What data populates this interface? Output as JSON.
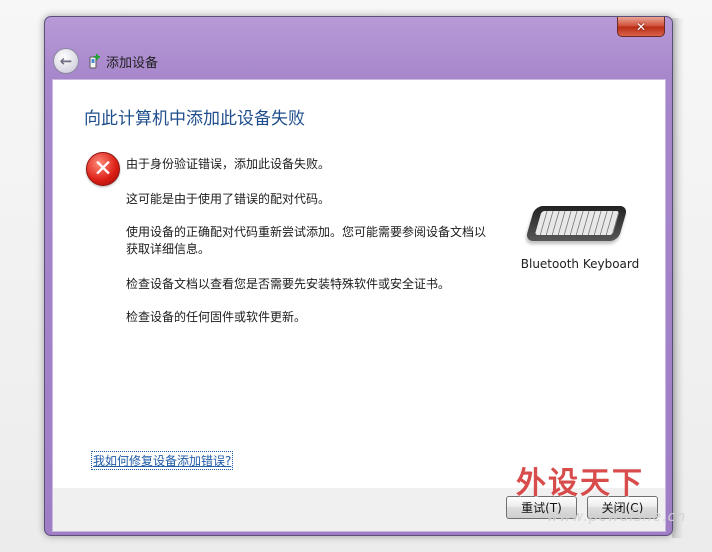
{
  "window": {
    "title": "添加设备",
    "close_label": "✕"
  },
  "navigation": {
    "back_label": "←"
  },
  "content": {
    "heading": "向此计算机中添加此设备失败",
    "messages": [
      "由于身份验证错误，添加此设备失败。",
      "这可能是由于使用了错误的配对代码。",
      "使用设备的正确配对代码重新尝试添加。您可能需要参阅设备文档以获取详细信息。",
      "检查设备文档以查看您是否需要先安装特殊软件或安全证书。",
      "检查设备的任何固件或软件更新。"
    ],
    "device_label": "Bluetooth Keyboard",
    "help_link": "我如何修复设备添加错误?"
  },
  "footer": {
    "retry_label": "重试(T)",
    "close_label": "关闭(C)"
  },
  "watermark": {
    "text": "外设天下",
    "url": "www.pcwaishe.cn"
  },
  "colors": {
    "accent": "#1e4e8c",
    "error": "#dc1f16",
    "titlebar": "#a786cb"
  }
}
